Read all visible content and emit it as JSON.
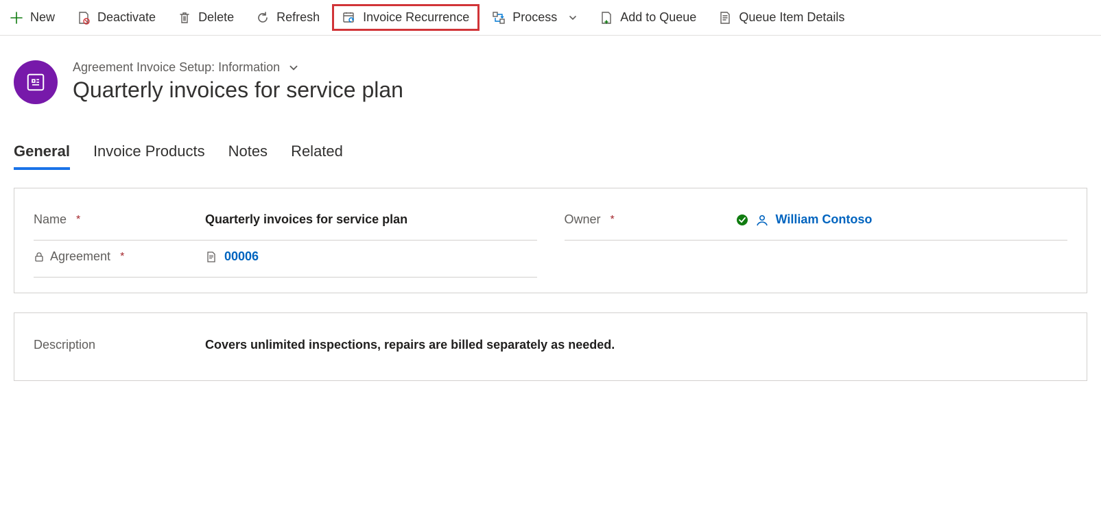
{
  "commandBar": {
    "new": "New",
    "deactivate": "Deactivate",
    "delete": "Delete",
    "refresh": "Refresh",
    "invoiceRecurrence": "Invoice Recurrence",
    "process": "Process",
    "addToQueue": "Add to Queue",
    "queueItemDetails": "Queue Item Details"
  },
  "header": {
    "formName": "Agreement Invoice Setup: Information",
    "title": "Quarterly invoices for service plan"
  },
  "tabs": {
    "general": "General",
    "invoiceProducts": "Invoice Products",
    "notes": "Notes",
    "related": "Related"
  },
  "fields": {
    "nameLabel": "Name",
    "nameValue": "Quarterly invoices for service plan",
    "ownerLabel": "Owner",
    "ownerValue": "William Contoso",
    "agreementLabel": "Agreement",
    "agreementValue": "00006",
    "descriptionLabel": "Description",
    "descriptionValue": "Covers unlimited inspections, repairs are billed separately as needed."
  }
}
